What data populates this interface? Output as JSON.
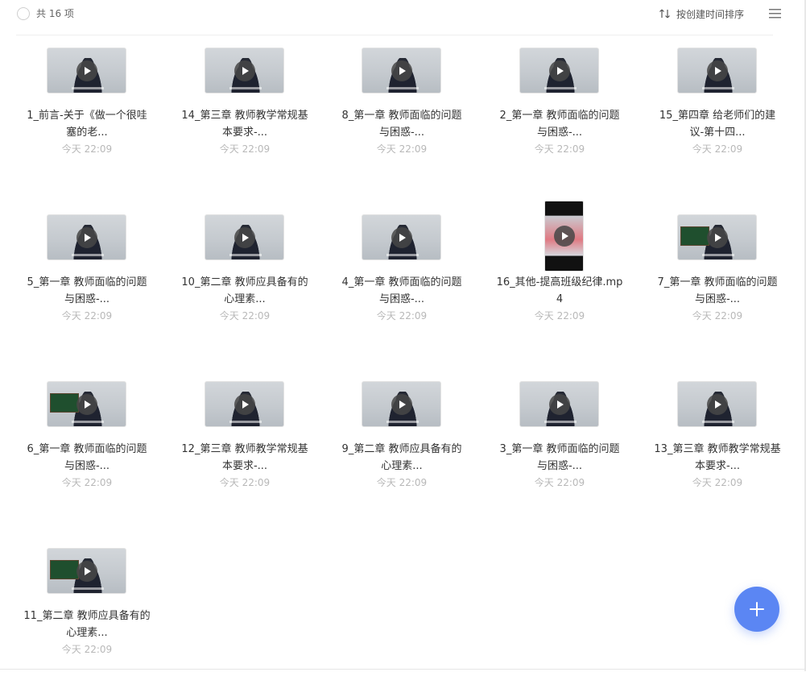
{
  "header": {
    "count_label": "共 16 项",
    "sort_label": "按创建时间排序"
  },
  "items": [
    {
      "name": "1_前言-关于《做一个很哇塞的老...",
      "time": "今天 22:09",
      "thumb": "standard"
    },
    {
      "name": "14_第三章 教师教学常规基本要求-...",
      "time": "今天 22:09",
      "thumb": "standard"
    },
    {
      "name": "8_第一章 教师面临的问题与困惑-...",
      "time": "今天 22:09",
      "thumb": "standard"
    },
    {
      "name": "2_第一章 教师面临的问题与困惑-...",
      "time": "今天 22:09",
      "thumb": "standard"
    },
    {
      "name": "15_第四章 给老师们的建议-第十四...",
      "time": "今天 22:09",
      "thumb": "standard"
    },
    {
      "name": "5_第一章 教师面临的问题与困惑-...",
      "time": "今天 22:09",
      "thumb": "standard"
    },
    {
      "name": "10_第二章 教师应具备有的心理素...",
      "time": "今天 22:09",
      "thumb": "standard"
    },
    {
      "name": "4_第一章 教师面临的问题与困惑-...",
      "time": "今天 22:09",
      "thumb": "standard"
    },
    {
      "name": "16_其他-提高班级纪律.mp4",
      "time": "今天 22:09",
      "thumb": "portrait"
    },
    {
      "name": "7_第一章 教师面临的问题与困惑-...",
      "time": "今天 22:09",
      "thumb": "board"
    },
    {
      "name": "6_第一章 教师面临的问题与困惑-...",
      "time": "今天 22:09",
      "thumb": "board"
    },
    {
      "name": "12_第三章 教师教学常规基本要求-...",
      "time": "今天 22:09",
      "thumb": "standard"
    },
    {
      "name": "9_第二章 教师应具备有的心理素...",
      "time": "今天 22:09",
      "thumb": "standard"
    },
    {
      "name": "3_第一章 教师面临的问题与困惑-...",
      "time": "今天 22:09",
      "thumb": "standard"
    },
    {
      "name": "13_第三章 教师教学常规基本要求-...",
      "time": "今天 22:09",
      "thumb": "standard"
    },
    {
      "name": "11_第二章 教师应具备有的心理素...",
      "time": "今天 22:09",
      "thumb": "board"
    }
  ],
  "icons": {
    "sort": "sort-arrows-icon",
    "menu": "list-menu-icon",
    "add": "plus-icon"
  },
  "colors": {
    "accent": "#5b86f3",
    "time_text": "#b8b8b8"
  }
}
